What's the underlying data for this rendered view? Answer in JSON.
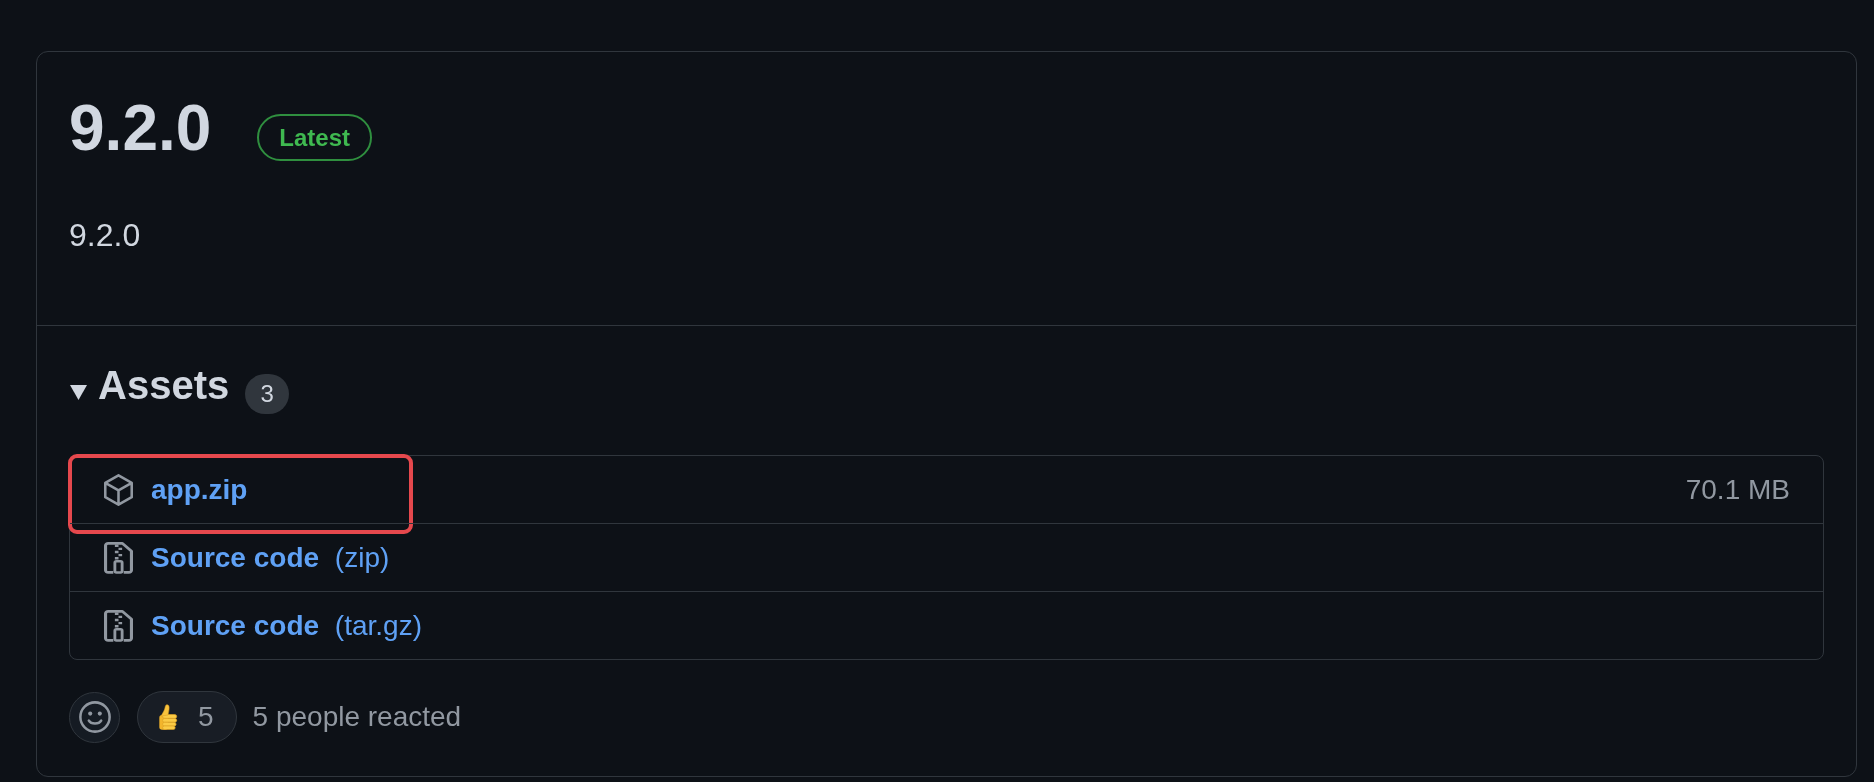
{
  "release": {
    "title": "9.2.0",
    "badge": "Latest",
    "body": "9.2.0"
  },
  "assets": {
    "heading": "Assets",
    "count": "3",
    "expanded": true,
    "items": [
      {
        "kind": "package",
        "name": "app.zip",
        "size": "70.1 MB",
        "highlighted": true
      },
      {
        "kind": "source",
        "name": "Source code",
        "format": "(zip)",
        "highlighted": false
      },
      {
        "kind": "source",
        "name": "Source code",
        "format": "(tar.gz)",
        "highlighted": false
      }
    ]
  },
  "reactions": {
    "items": [
      {
        "kind": "thumbs_up",
        "count": "5"
      }
    ],
    "summary": "5 people reacted"
  }
}
